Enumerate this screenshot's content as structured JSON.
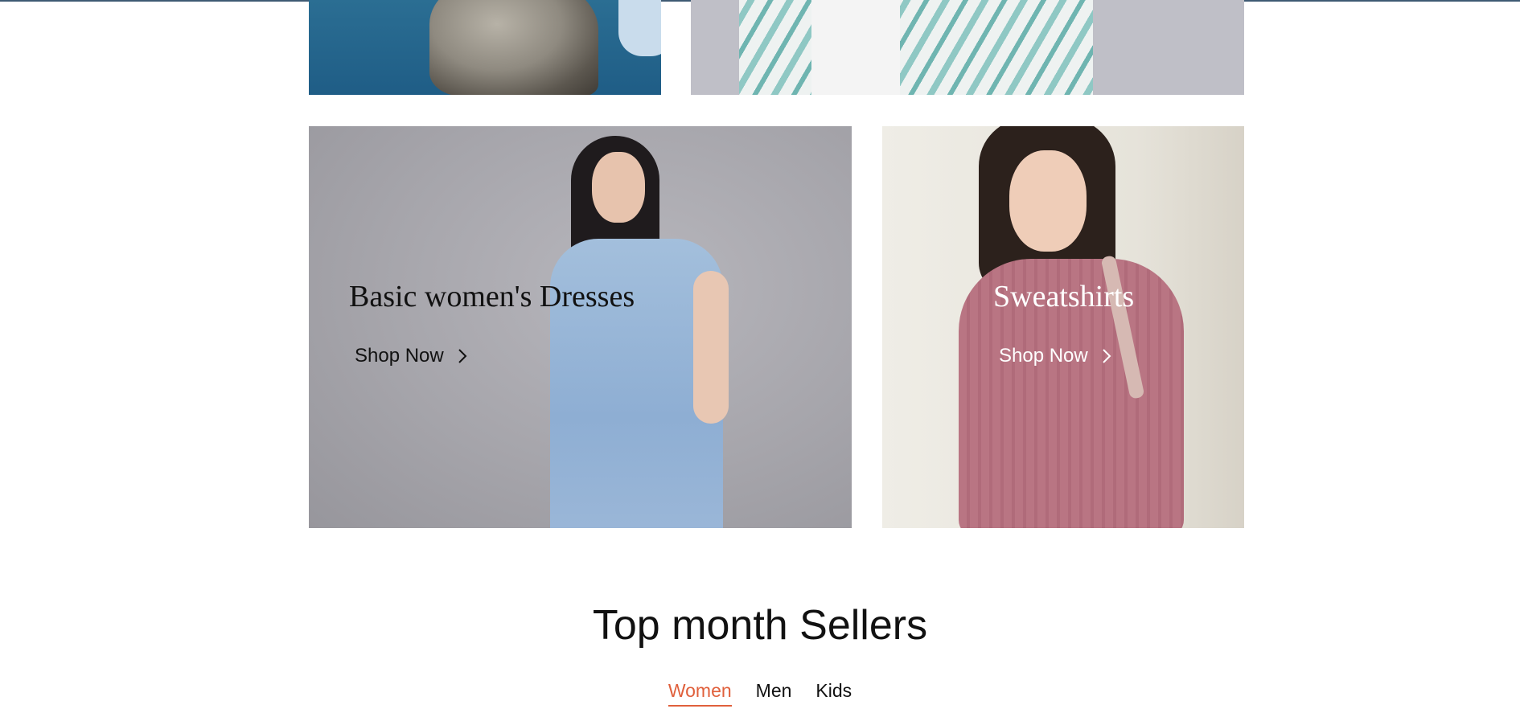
{
  "promos": [
    {
      "title": "Basic women's Dresses",
      "cta": "Shop Now"
    },
    {
      "title": "Sweatshirts",
      "cta": "Shop Now"
    }
  ],
  "top_sellers": {
    "title": "Top month Sellers",
    "tabs": [
      {
        "label": "Women",
        "active": true
      },
      {
        "label": "Men",
        "active": false
      },
      {
        "label": "Kids",
        "active": false
      }
    ]
  },
  "colors": {
    "accent": "#e0603c",
    "text": "#111111"
  },
  "icons": {
    "cta_icon": "chevron-right-icon"
  }
}
